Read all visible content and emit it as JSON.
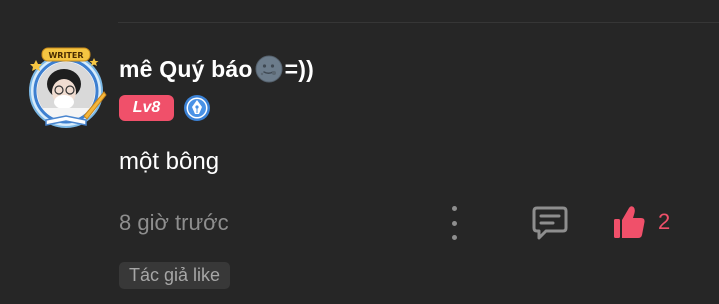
{
  "comment": {
    "author": {
      "name_prefix": "mê Quý báo",
      "name_suffix": "=))",
      "avatar_frame_text": "WRITER",
      "level": "Lv8",
      "icons": {
        "avatar": "avatar-icon",
        "name_emoji": "new-moon-face-icon",
        "badge": "pen-nib-badge-icon"
      }
    },
    "text": "một bông",
    "timestamp": "8 giờ trước",
    "likes": "2",
    "author_liked_label": "Tác giả like",
    "actions": {
      "more": "more-vertical-icon",
      "reply": "comment-icon",
      "like": "thumbs-up-icon"
    }
  },
  "colors": {
    "background": "#262626",
    "accent": "#f0506a",
    "muted_text": "#8e8e8e",
    "badge_blue": "#3b82d6"
  }
}
